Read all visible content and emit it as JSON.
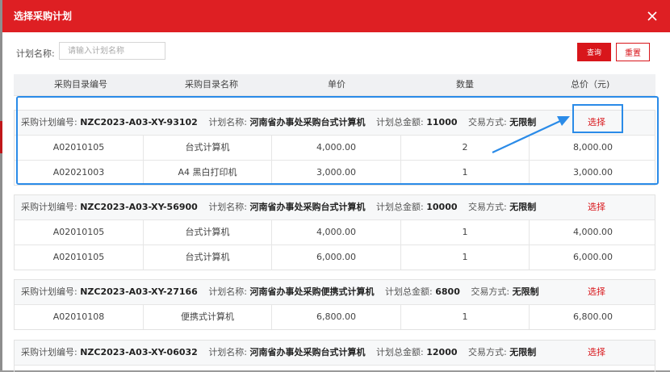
{
  "dialog": {
    "title": "选择采购计划",
    "close_icon": "close-icon"
  },
  "search": {
    "label": "计划名称:",
    "placeholder": "请输入计划名称",
    "value": "",
    "query_label": "查询",
    "reset_label": "重置"
  },
  "table": {
    "headers": [
      "采购目录编号",
      "采购目录名称",
      "单价",
      "数量",
      "总价（元)"
    ]
  },
  "labels": {
    "plan_no": "采购计划编号:",
    "plan_name": "计划名称:",
    "plan_total": "计划总金额:",
    "trade_method": "交易方式:",
    "select": "选择"
  },
  "plans": [
    {
      "plan_no": "NZC2023-A03-XY-93102",
      "plan_name": "河南省办事处采购台式计算机",
      "plan_total": "11000",
      "trade_method": "无限制",
      "rows": [
        {
          "code": "A02010105",
          "name": "台式计算机",
          "price": "4,000.00",
          "qty": "2",
          "total": "8,000.00"
        },
        {
          "code": "A02021003",
          "name": "A4 黑白打印机",
          "price": "3,000.00",
          "qty": "1",
          "total": "3,000.00"
        }
      ]
    },
    {
      "plan_no": "NZC2023-A03-XY-56900",
      "plan_name": "河南省办事处采购台式计算机",
      "plan_total": "10000",
      "trade_method": "无限制",
      "rows": [
        {
          "code": "A02010105",
          "name": "台式计算机",
          "price": "4,000.00",
          "qty": "1",
          "total": "4,000.00"
        },
        {
          "code": "A02010105",
          "name": "台式计算机",
          "price": "6,000.00",
          "qty": "1",
          "total": "6,000.00"
        }
      ]
    },
    {
      "plan_no": "NZC2023-A03-XY-27166",
      "plan_name": "河南省办事处采购便携式计算机",
      "plan_total": "6800",
      "trade_method": "无限制",
      "rows": [
        {
          "code": "A02010108",
          "name": "便携式计算机",
          "price": "6,800.00",
          "qty": "1",
          "total": "6,800.00"
        }
      ]
    },
    {
      "plan_no": "NZC2023-A03-XY-06032",
      "plan_name": "河南省办事处采购台式计算机",
      "plan_total": "12000",
      "trade_method": "无限制",
      "rows": []
    }
  ],
  "colors": {
    "brand_red": "#de1f23",
    "annotation_blue": "#2a8be8"
  }
}
